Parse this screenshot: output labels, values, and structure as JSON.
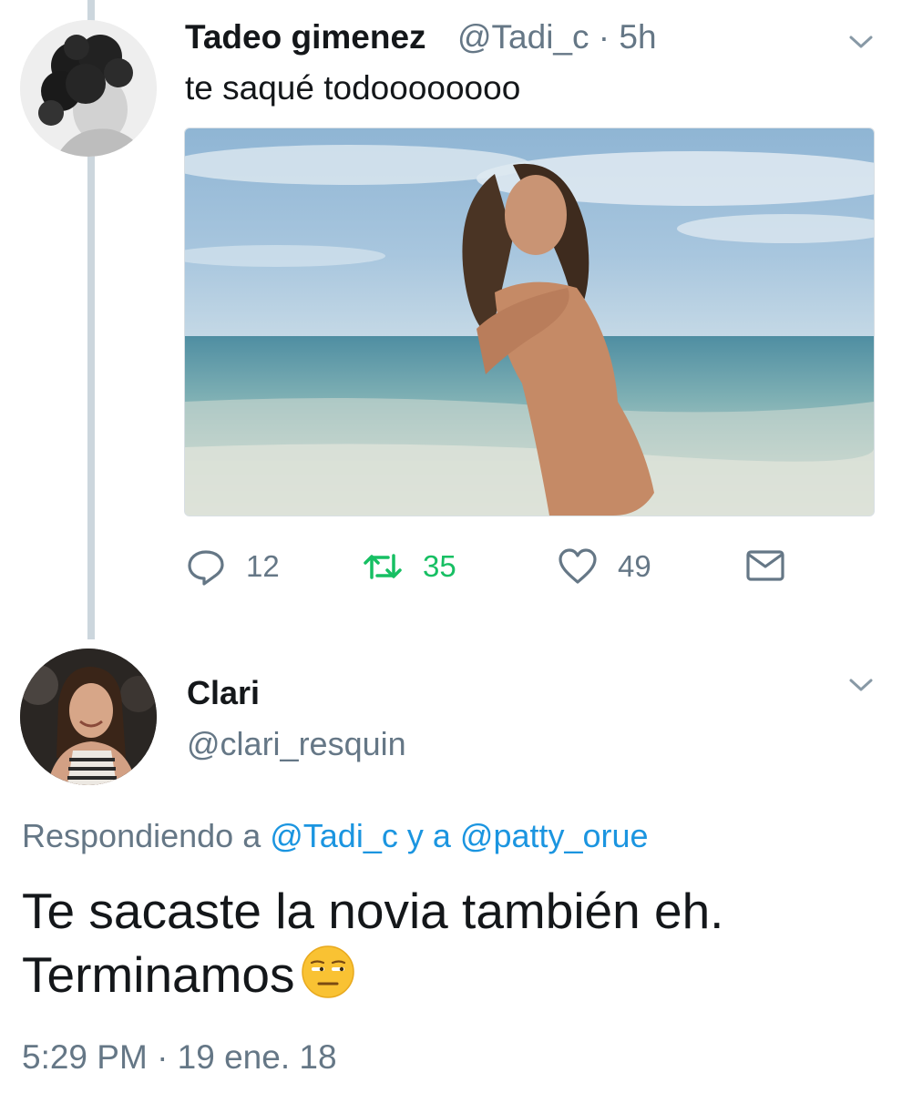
{
  "tweet1": {
    "display_name": "Tadeo gimenez",
    "handle_time": "@Tadi_c · 5h",
    "text": "te saqué todoooooooo",
    "actions": {
      "reply_count": "12",
      "retweet_count": "35",
      "like_count": "49"
    },
    "retweet_color": "#17bf63"
  },
  "tweet2": {
    "display_name": "Clari",
    "handle": "@clari_resquin",
    "replying": {
      "prefix": "Respondiendo a",
      "user1": "@Tadi_c",
      "connector": "y a",
      "user2": "@patty_orue"
    },
    "text_line1": "Te sacaste la novia también eh.",
    "text_line2": "Terminamos",
    "emoji": "expressionless-unamused-face-emoji",
    "timestamp": "5:29 PM · 19 ene. 18"
  },
  "colors": {
    "primary_text": "#14171a",
    "secondary_text": "#657786",
    "link": "#1b95e0",
    "thread_line": "#ccd6dd"
  }
}
